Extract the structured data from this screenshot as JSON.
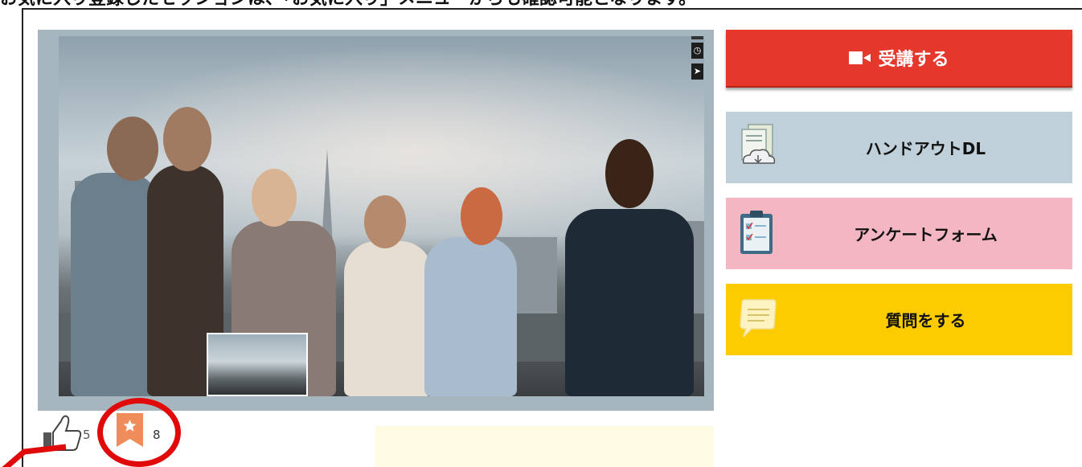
{
  "header": {
    "caption": "お気に入り登録したセッションは、「お気に入り」メニューからも確認可能となります。"
  },
  "video": {
    "controls": [
      {
        "name": "clock-icon",
        "glyph": "◷"
      },
      {
        "name": "send-icon",
        "glyph": "➤"
      }
    ]
  },
  "sidebar": {
    "attend_label": "受講する",
    "handout_label": "ハンドアウトDL",
    "survey_label": "アンケートフォーム",
    "question_label": "質問をする"
  },
  "reactions": {
    "likes": "5",
    "favorites": "8"
  },
  "colors": {
    "attend": "#e5372b",
    "handout": "#bfd0da",
    "survey": "#f4b6c2",
    "question": "#fccc00",
    "highlight": "#e00a0a",
    "bookmark": "#f08c5a"
  }
}
